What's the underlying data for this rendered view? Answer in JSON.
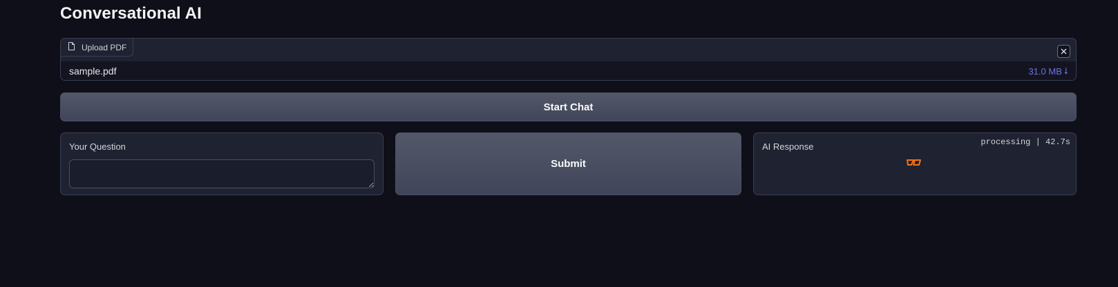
{
  "page": {
    "title": "Conversational AI"
  },
  "upload": {
    "label": "Upload PDF",
    "file_name": "sample.pdf",
    "file_size": "31.0 MB",
    "download_arrow": "⭣"
  },
  "start_chat": {
    "label": "Start Chat"
  },
  "question": {
    "label": "Your Question",
    "value": ""
  },
  "submit": {
    "label": "Submit"
  },
  "response": {
    "label": "AI Response",
    "status": "processing | 42.7s"
  },
  "colors": {
    "background": "#0e0f18",
    "panel": "#1f2230",
    "button": "#4a4f62",
    "link": "#6e74e8",
    "loader": "#f97316"
  },
  "icons": {
    "upload_label_icon": "file-icon",
    "clear": "close-icon",
    "download": "download-arrow-icon",
    "loader": "loading-spinner-icon"
  }
}
